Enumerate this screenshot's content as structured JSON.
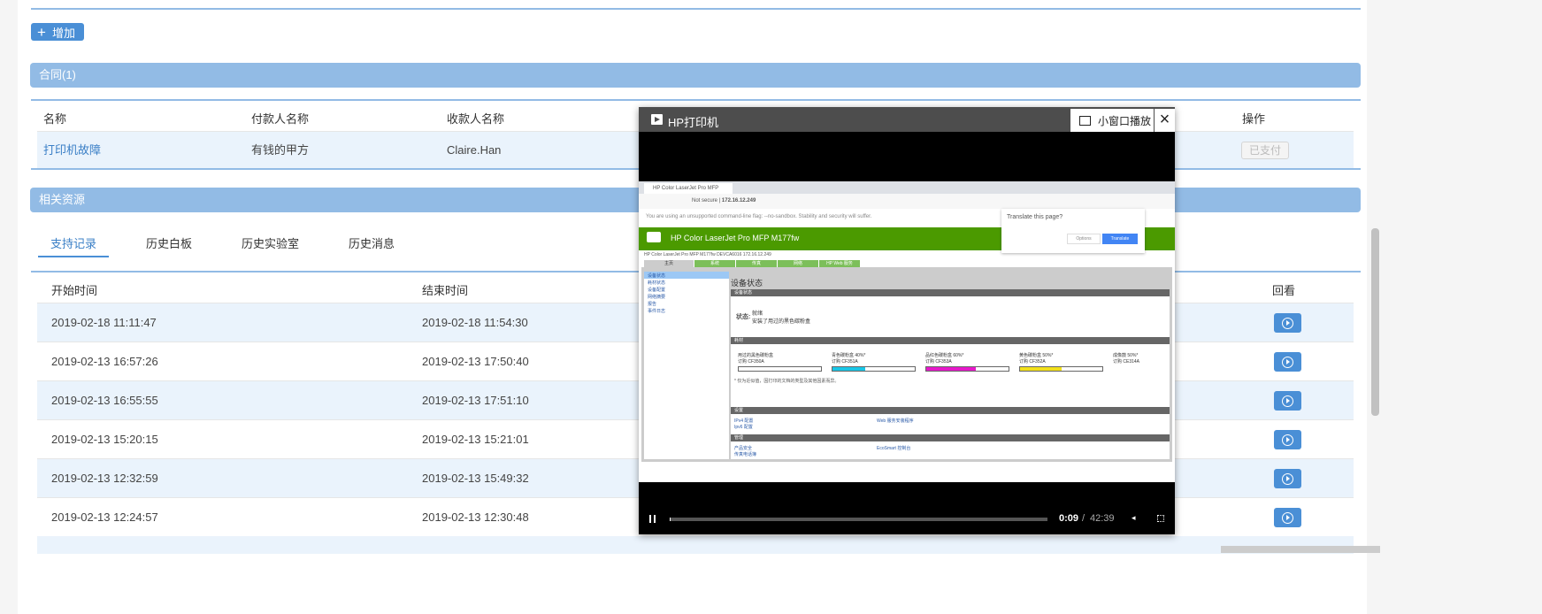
{
  "toolbar": {
    "add_label": "增加"
  },
  "contract": {
    "section_title": "合同(1)",
    "columns": [
      "名称",
      "付款人名称",
      "收款人名称",
      "操作"
    ],
    "rows": [
      {
        "name": "打印机故障",
        "payer": "有钱的甲方",
        "payee": "Claire.Han",
        "action": "已支付"
      }
    ]
  },
  "resources": {
    "section_title": "相关资源",
    "tabs": [
      "支持记录",
      "历史白板",
      "历史实验室",
      "历史消息"
    ],
    "columns": [
      "开始时间",
      "结束时间",
      "回看"
    ],
    "rows": [
      {
        "start": "2019-02-18 11:11:47",
        "end": "2019-02-18 11:54:30"
      },
      {
        "start": "2019-02-13 16:57:26",
        "end": "2019-02-13 17:50:40"
      },
      {
        "start": "2019-02-13 16:55:55",
        "end": "2019-02-13 17:51:10"
      },
      {
        "start": "2019-02-13 15:20:15",
        "end": "2019-02-13 15:21:01"
      },
      {
        "start": "2019-02-13 12:32:59",
        "end": "2019-02-13 15:49:32"
      },
      {
        "start": "2019-02-13 12:24:57",
        "end": "2019-02-13 12:30:48"
      }
    ]
  },
  "video": {
    "title": "HP打印机",
    "mini_label": "小窗口播放",
    "current_time": "0:09",
    "separator": "/",
    "duration": "42:39",
    "progress": 0.0035,
    "screen": {
      "tab_title": "HP Color LaserJet Pro MFP",
      "not_secure": "Not secure",
      "url": "172.16.12.249",
      "warning": "You are using an unsupported command-line flag: --no-sandbox. Stability and security will suffer.",
      "translate_prompt": "Translate this page?",
      "options": "Options",
      "translate": "Translate",
      "banner": "HP Color LaserJet Pro MFP M177fw",
      "subline": "HP Color LaserJet Pro MFP M177fw   DEVCA6016   172.16.12.249",
      "nav_tabs": [
        "主页",
        "系统",
        "传真",
        "网络",
        "HP Web 服务"
      ],
      "side_links": [
        "设备状态",
        "耗材状态",
        "设备配置",
        "网络摘要",
        "报告",
        "事件日志"
      ],
      "page_title": "设备状态",
      "status_bar": "设备状态",
      "status_label": "状态:",
      "status_lines": [
        "就绪",
        "安装了用过的黑色碳粉盒"
      ],
      "supplies_bar": "耗材",
      "supplies": [
        {
          "name": "用过的黑色碳粉盒",
          "order": "订购 CF350A",
          "level": 0,
          "color": "#ffffff"
        },
        {
          "name": "青色碳粉盒 40%*",
          "order": "订购 CF351A",
          "level": 40,
          "color": "#19c6e6"
        },
        {
          "name": "品红色碳粉盒 60%*",
          "order": "订购 CF353A",
          "level": 60,
          "color": "#e619c9"
        },
        {
          "name": "黄色碳粉盒 50%*",
          "order": "订购 CF352A",
          "level": 50,
          "color": "#f2e01a"
        },
        {
          "name": "成像鼓 50%*",
          "order": "订购 CE314A",
          "level": null,
          "color": "#ffffff"
        }
      ],
      "note": "* 仅为近似值，因打印的文档的类型及其他因素而异。",
      "settings_bar": "设置",
      "settings_links": [
        "IPv4 配置",
        "Ipv6 配置",
        "Web 服务安装程序"
      ],
      "manage_bar": "管理",
      "manage_links": [
        "产品安全",
        "传真电话簿",
        "EcoSmart 控制台"
      ]
    }
  }
}
